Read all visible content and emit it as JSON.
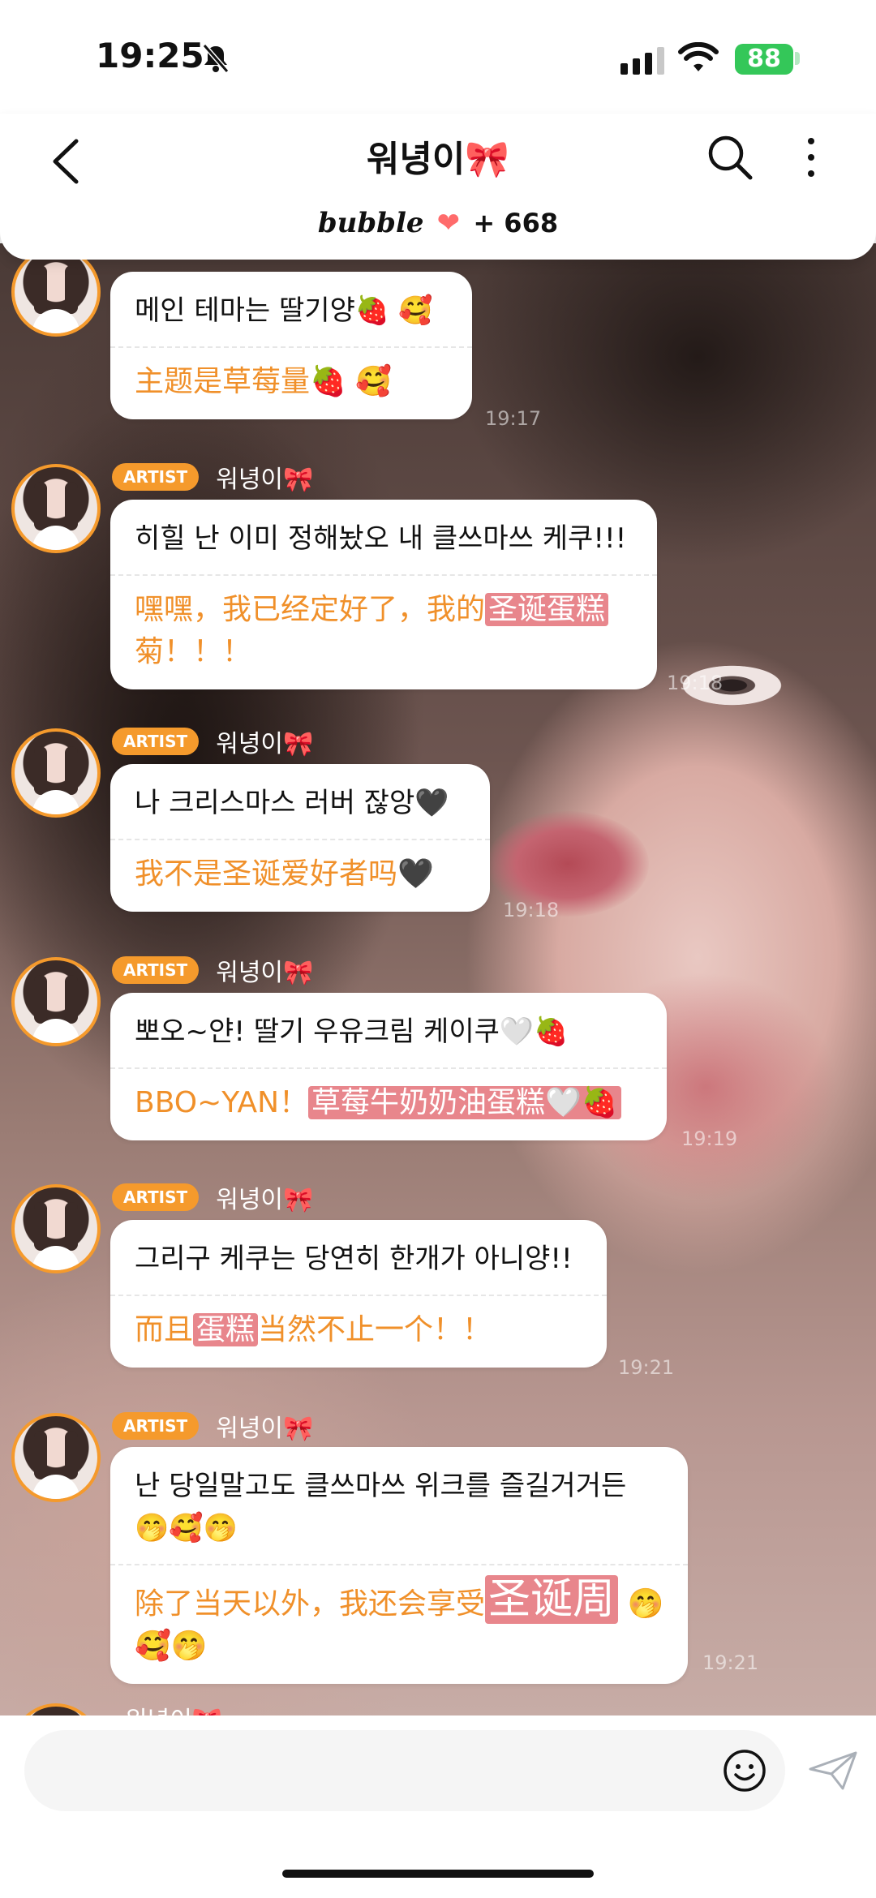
{
  "status_bar": {
    "time": "19:25",
    "battery": "88"
  },
  "header": {
    "title": "워녕이🎀",
    "brand": "bubble",
    "heart": "❤",
    "subscriber_count": "+ 668"
  },
  "messages": [
    {
      "show_head": false,
      "ko": "메인 테마는 딸기양🍓 🥰",
      "zh_parts": [
        {
          "t": "主题是草莓量🍓 🥰",
          "hl": false
        }
      ],
      "time": "19:17"
    },
    {
      "badge": "ARTIST",
      "sender": "워녕이🎀",
      "ko": "히힐 난 이미 정해놨오 내 클쓰마쓰 케쿠!!!",
      "zh_parts": [
        {
          "t": "嘿嘿，我已经定好了，我的",
          "hl": false
        },
        {
          "t": "圣诞蛋糕",
          "hl": true
        },
        {
          "t": "菊！！！",
          "hl": false
        }
      ],
      "time": "19:18"
    },
    {
      "badge": "ARTIST",
      "sender": "워녕이🎀",
      "ko": "나 크리스마스 러버 잖앙🖤",
      "zh_parts": [
        {
          "t": "我不是圣诞爱好者吗🖤",
          "hl": false
        }
      ],
      "time": "19:18"
    },
    {
      "badge": "ARTIST",
      "sender": "워녕이🎀",
      "ko": "뽀오~얀! 딸기 우유크림 케이쿠🤍🍓",
      "zh_parts": [
        {
          "t": "BBO~YAN！",
          "hl": false
        },
        {
          "t": "草莓牛奶奶油蛋糕🤍🍓",
          "hl": true
        }
      ],
      "time": "19:19"
    },
    {
      "badge": "ARTIST",
      "sender": "워녕이🎀",
      "ko": "그리구 케쿠는 당연히 한개가 아니양!!",
      "zh_parts": [
        {
          "t": "而且",
          "hl": false
        },
        {
          "t": "蛋糕",
          "hl": true
        },
        {
          "t": "当然不止一个！！",
          "hl": false
        }
      ],
      "time": "19:21"
    },
    {
      "badge": "ARTIST",
      "sender": "워녕이🎀",
      "ko": "난 당일말고도 클쓰마쓰 위크를 즐길거거든 🤭🥰🤭",
      "zh_parts": [
        {
          "t": "除了当天以外，我还会享受",
          "hl": false
        },
        {
          "t": "圣诞周",
          "hl": true,
          "big": true
        },
        {
          "t": " 🤭🥰🤭",
          "hl": false
        }
      ],
      "time": "19:21"
    }
  ],
  "next_sender": "워녕이🎀",
  "input": {
    "placeholder": ""
  },
  "colors": {
    "accent": "#f59a2c",
    "translation": "#f0902a",
    "highlight": "#e8868c"
  },
  "icons": [
    "back-icon",
    "search-icon",
    "more-icon",
    "bell-off-icon",
    "signal-icon",
    "wifi-icon",
    "emoji-icon",
    "send-icon"
  ]
}
